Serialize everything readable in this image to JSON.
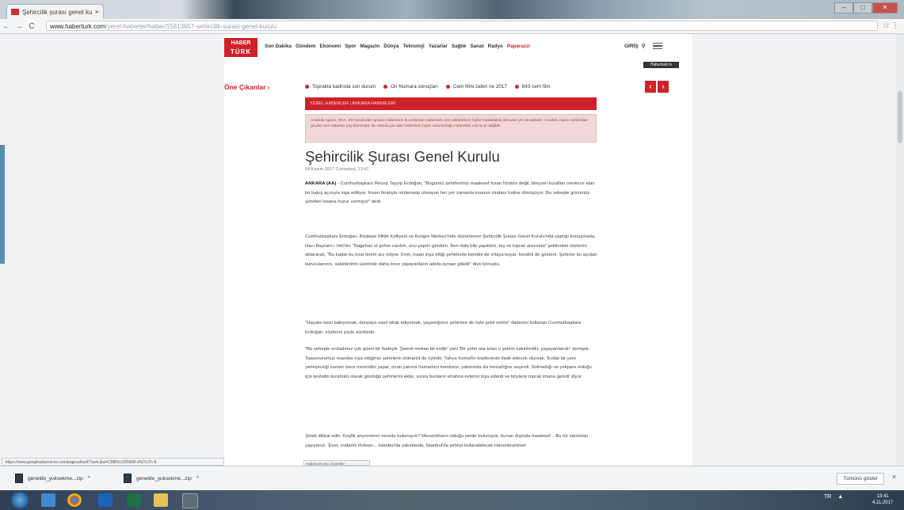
{
  "browser": {
    "tab_title": "Şehircilik şurası genel ku",
    "tab_close": "×",
    "url_host": "www.haberturk.com",
    "url_path": "/yerel-haberler/haber/15813657-sehircilik-surasi-genel-kurulu",
    "back": "←",
    "forward": "→",
    "reload": "C",
    "bookmark_star": "☆",
    "menu": "⋮",
    "window_min": "–",
    "window_max": "□",
    "window_close": "✕"
  },
  "site": {
    "logo_line1": "HABER",
    "logo_line2": "TÜRK",
    "nav": [
      "Son Dakika",
      "Gündem",
      "Ekonomi",
      "Spor",
      "Magazin",
      "Dünya",
      "Teknoloji",
      "Yazarlar",
      "Sağlık",
      "Sanat",
      "Radyo",
      "Paparazzi"
    ],
    "login": "GİRİŞ",
    "search_icon": "search-icon",
    "dark_tag": "Haberturk.tv"
  },
  "featured": {
    "label": "Öne Çıkanlar ›",
    "items": [
      "Toprakta kadroda son durum",
      "On Numara sonuçları",
      "Cem filmi zaferi ne 2017",
      "843 cem film"
    ],
    "prev": "‹",
    "next": "›"
  },
  "article": {
    "category": "YEREL HABERLER | ANKARA HABERLERİ",
    "notice": "Anadolu Ajansı, DHA, İHA tarafından geçilen haberlerin bu bölümde Habertürk.com editörlerinin hiçbir müdahalesi olmadan yer almaktadır. Anadolu Ajansı tarafından geçilen tüm haberler yayınlanmıştır. Bu alanda yer alan haberlerin hiçbir sorumluluğu Habertürk.com'a ait değildir.",
    "title": "Şehircilik Şurası Genel Kurulu",
    "date": "04 Kasım 2017 Cumartesi, 13:41",
    "p1_lead": "ANKARA (AA)",
    "p1": " - Cumhurbaşkanı Recep Tayyip Erdoğan, \"Bugünkü şehirlerimiz maalesef insan fıtratını değil, bireysel kuralları merkeze alan bir bakış açısıyla inşa ediliyor. İnsan fıtratıyla mütenasip olmayan her yer zamanla insanın zindanı haline dönüşüyor. Bu sebeple günümüz şehirleri insana huzur vermiyor\" dedi.",
    "p2": "Cumhurbaşkanı Erdoğan, Beştepe Millet Külliyesi ve Kongre Merkezi'nde düzenlenen Şehircilik Şurası Genel Kurulu'nda yaptığı konuşmada, Hacı Bayram-ı Veli'nin \"Nagehan ol şehre vardım, onu yapılır gördüm. Ben dahi bile yapıldım, taş ve toprak arasında\" şeklindeki sözlerini aktararak, \"Bu kadar bu kısa önem arz ediyor. Evet, insan inşa ettiği şehirlerde kendini de ortaya koyar, kendini de gösterir. Şehirler bu açıdan kurucularının, sakinlerinin üzerinde daha önce yaşayanların adeta aynası gibidir\" diye konuştu.",
    "p3": "\"Hayata nasıl bakıyorsak, dünyaya nasıl idrak ediyorsak, yaşadığımız şehirlere de öyle şekil veririz\" ifadesini kullanan Cumhurbaşkanı Erdoğan, sözlerini şöyle sürdürdü:",
    "p4": "\"Bu sebeple ecdadımız çok güzel bir ifadeyle 'Şeerdi mekan bil evdiir' yani 'Bir şehri süz kılan o şehrin sakinleridir, yaşayanlarıdır' demiştir. Tasavvurumuz mazeba inşa ettiğimiz şehirlerin mimarisi de öyledir. Yahya Kemal'in kopilerinde ifade edecek olursak, 'Evdat bir yere yerleşeceği zaman önce mescidini yapar, onun yanına hamamını kondurur, yakınında da mezarlığını seçerdi. Solmadığı ve yekpare olduğu için tevhidin tezahürü olarak gördüğü şehirlerini ekler, sonra bunların etrafına evlerini inşa ederdi ve böylece toprak imana gelirdi' diyor.",
    "p5": "Şimdi dikkat edin. Keşfik anyonsrnın nerede bulunuyor? Mezarlıkların olduğu yerde bulunuyor, bunun dışında maalesef... Bu tür sıkıntıları yaşıyoruz. 'Evet, evdamlı Rıdvan... Istanbul'da yakınlarda, İstanbul'da şehriyi bulunabilecek Hanımkrahimet"
  },
  "status": {
    "url_left": "https://www.googleadservices.com/pagead/aclk?sa=L&ai=CMBXn3ZRdWl-vNJ7uTh-8",
    "url_mid": "Haberturk-gezi ziyaretler"
  },
  "downloads": {
    "file1": "genelde_yuksekme...zip",
    "file2": "genelde_yuksekme...zip",
    "caret": "^",
    "show_all": "Tümünü göster",
    "close": "×"
  },
  "taskbar": {
    "tray_lang": "TR",
    "tray_arrow": "▲",
    "clock_time": "13:41",
    "clock_date": "4.11.2017"
  },
  "colors": {
    "brand_red": "#d0212a",
    "notice_bg": "#f2d7d7"
  }
}
